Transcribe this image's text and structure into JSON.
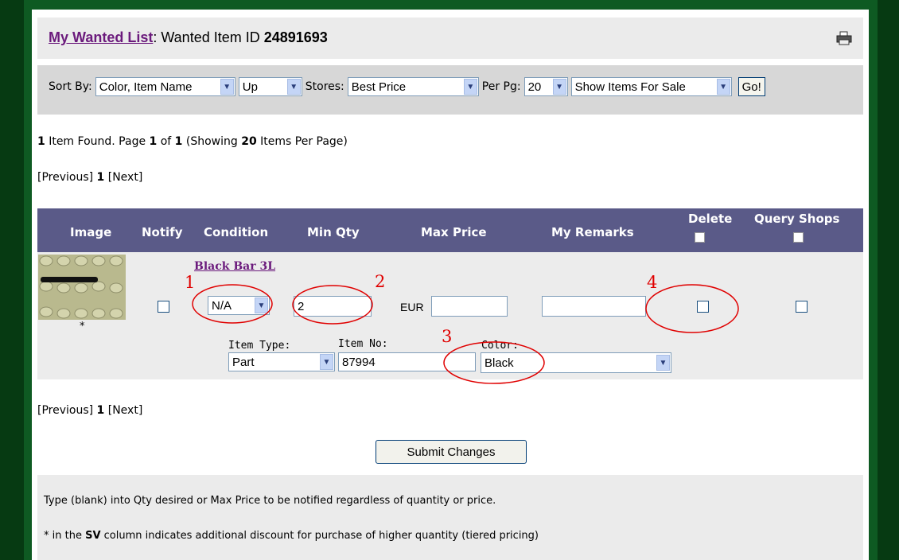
{
  "header": {
    "list_link": "My Wanted List",
    "title_mid": ": Wanted Item ID ",
    "item_id": "24891693"
  },
  "sortbar": {
    "sort_label": "Sort By:",
    "sort_value": "Color, Item Name",
    "dir_value": "Up",
    "stores_label": "Stores:",
    "stores_value": "Best Price",
    "per_label": "Per Pg:",
    "per_value": "20",
    "show_value": "Show Items For Sale",
    "go_label": "Go!"
  },
  "results": {
    "count": "1",
    "found_text": " Item Found. Page ",
    "page": "1",
    "of_text": " of ",
    "total_pages": "1",
    "showing_prefix": " (Showing ",
    "per_page": "20",
    "showing_suffix": " Items Per Page)"
  },
  "pager": {
    "previous": "[Previous]",
    "page": "1",
    "next": "[Next]"
  },
  "table": {
    "headers": [
      "Image",
      "Notify",
      "Condition",
      "Min Qty",
      "Max Price",
      "My Remarks",
      "Delete",
      "Query Shops"
    ],
    "row": {
      "item_name": "Black Bar 3L",
      "asterisk": "*",
      "condition": "N/A",
      "min_qty": "2",
      "currency": "EUR",
      "max_price": "",
      "remarks": "",
      "item_type_label": "Item Type:",
      "item_type": "Part",
      "item_no_label": "Item No:",
      "item_no": "87994",
      "color_label": "Color:",
      "color": "Black"
    }
  },
  "annotations": [
    "1",
    "2",
    "3",
    "4"
  ],
  "submit_label": "Submit Changes",
  "footer": {
    "note1": "Type (blank) into Qty desired or Max Price to be notified regardless of quantity or price.",
    "note2_prefix": "* in the ",
    "note2_bold": "SV",
    "note2_suffix": " column indicates additional discount for purchase of higher quantity (tiered pricing)"
  },
  "colors": {
    "header_bg": "#5a5a88",
    "frame": "#0e5a22",
    "link": "#6b1a7c",
    "annotation": "#e00000"
  }
}
